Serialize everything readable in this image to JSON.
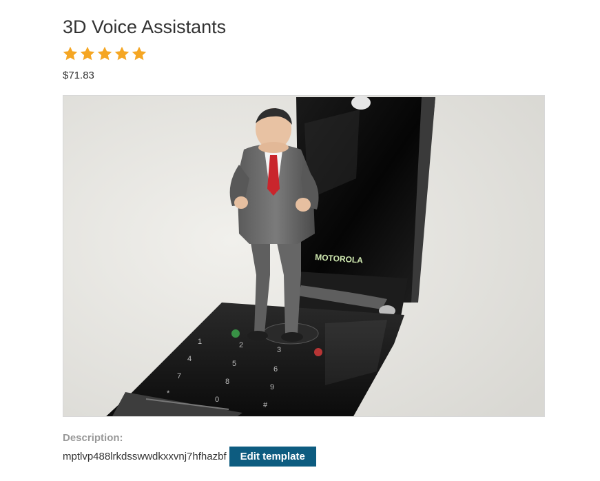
{
  "product": {
    "title": "3D Voice Assistants",
    "rating": 5,
    "rating_max": 5,
    "star_color": "#f5a623",
    "price": "$71.83"
  },
  "image": {
    "phone_brand_text": "MOTOROLA"
  },
  "description": {
    "label": "Description:",
    "text": "mptlvp488lrkdsswwdkxxvnj7hfhazbf",
    "edit_button_label": "Edit template",
    "button_color": "#0d5c80"
  }
}
